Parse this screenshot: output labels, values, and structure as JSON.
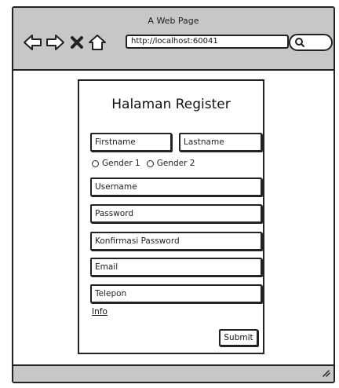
{
  "window": {
    "title": "A Web Page"
  },
  "browser": {
    "url": "http://localhost:60041"
  },
  "form": {
    "title": "Halaman Register",
    "firstname_placeholder": "Firstname",
    "lastname_placeholder": "Lastname",
    "gender1_label": "Gender 1",
    "gender2_label": "Gender 2",
    "username_placeholder": "Username",
    "password_placeholder": "Password",
    "confirm_password_placeholder": "Konfirmasi Password",
    "email_placeholder": "Email",
    "telepon_placeholder": "Telepon",
    "info_link": "Info",
    "submit_label": "Submit"
  },
  "icons": {
    "back": "arrow-left-icon",
    "forward": "arrow-right-icon",
    "stop": "close-icon",
    "home": "home-icon",
    "search": "search-icon",
    "resize": "resize-grip-icon"
  }
}
